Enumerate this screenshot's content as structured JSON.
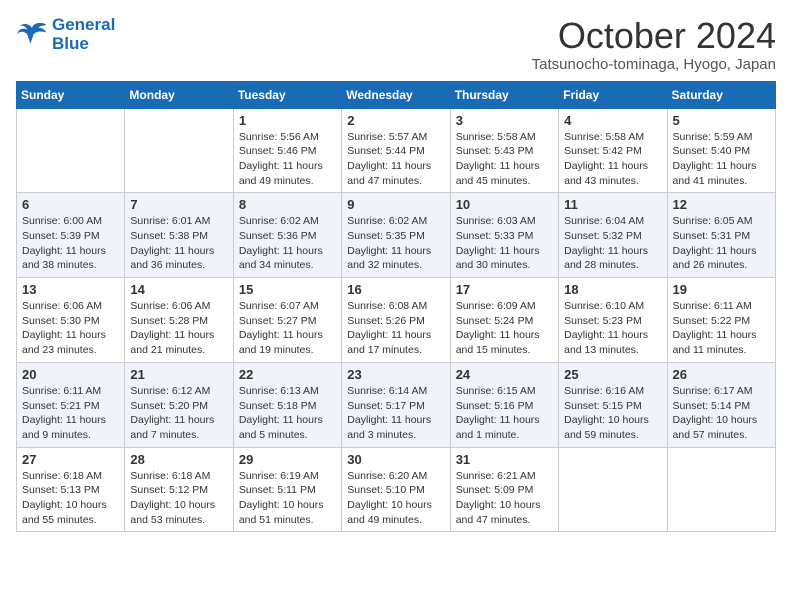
{
  "header": {
    "logo_line1": "General",
    "logo_line2": "Blue",
    "month": "October 2024",
    "location": "Tatsunocho-tominaga, Hyogo, Japan"
  },
  "weekdays": [
    "Sunday",
    "Monday",
    "Tuesday",
    "Wednesday",
    "Thursday",
    "Friday",
    "Saturday"
  ],
  "weeks": [
    [
      {
        "day": "",
        "sunrise": "",
        "sunset": "",
        "daylight": ""
      },
      {
        "day": "",
        "sunrise": "",
        "sunset": "",
        "daylight": ""
      },
      {
        "day": "1",
        "sunrise": "Sunrise: 5:56 AM",
        "sunset": "Sunset: 5:46 PM",
        "daylight": "Daylight: 11 hours and 49 minutes."
      },
      {
        "day": "2",
        "sunrise": "Sunrise: 5:57 AM",
        "sunset": "Sunset: 5:44 PM",
        "daylight": "Daylight: 11 hours and 47 minutes."
      },
      {
        "day": "3",
        "sunrise": "Sunrise: 5:58 AM",
        "sunset": "Sunset: 5:43 PM",
        "daylight": "Daylight: 11 hours and 45 minutes."
      },
      {
        "day": "4",
        "sunrise": "Sunrise: 5:58 AM",
        "sunset": "Sunset: 5:42 PM",
        "daylight": "Daylight: 11 hours and 43 minutes."
      },
      {
        "day": "5",
        "sunrise": "Sunrise: 5:59 AM",
        "sunset": "Sunset: 5:40 PM",
        "daylight": "Daylight: 11 hours and 41 minutes."
      }
    ],
    [
      {
        "day": "6",
        "sunrise": "Sunrise: 6:00 AM",
        "sunset": "Sunset: 5:39 PM",
        "daylight": "Daylight: 11 hours and 38 minutes."
      },
      {
        "day": "7",
        "sunrise": "Sunrise: 6:01 AM",
        "sunset": "Sunset: 5:38 PM",
        "daylight": "Daylight: 11 hours and 36 minutes."
      },
      {
        "day": "8",
        "sunrise": "Sunrise: 6:02 AM",
        "sunset": "Sunset: 5:36 PM",
        "daylight": "Daylight: 11 hours and 34 minutes."
      },
      {
        "day": "9",
        "sunrise": "Sunrise: 6:02 AM",
        "sunset": "Sunset: 5:35 PM",
        "daylight": "Daylight: 11 hours and 32 minutes."
      },
      {
        "day": "10",
        "sunrise": "Sunrise: 6:03 AM",
        "sunset": "Sunset: 5:33 PM",
        "daylight": "Daylight: 11 hours and 30 minutes."
      },
      {
        "day": "11",
        "sunrise": "Sunrise: 6:04 AM",
        "sunset": "Sunset: 5:32 PM",
        "daylight": "Daylight: 11 hours and 28 minutes."
      },
      {
        "day": "12",
        "sunrise": "Sunrise: 6:05 AM",
        "sunset": "Sunset: 5:31 PM",
        "daylight": "Daylight: 11 hours and 26 minutes."
      }
    ],
    [
      {
        "day": "13",
        "sunrise": "Sunrise: 6:06 AM",
        "sunset": "Sunset: 5:30 PM",
        "daylight": "Daylight: 11 hours and 23 minutes."
      },
      {
        "day": "14",
        "sunrise": "Sunrise: 6:06 AM",
        "sunset": "Sunset: 5:28 PM",
        "daylight": "Daylight: 11 hours and 21 minutes."
      },
      {
        "day": "15",
        "sunrise": "Sunrise: 6:07 AM",
        "sunset": "Sunset: 5:27 PM",
        "daylight": "Daylight: 11 hours and 19 minutes."
      },
      {
        "day": "16",
        "sunrise": "Sunrise: 6:08 AM",
        "sunset": "Sunset: 5:26 PM",
        "daylight": "Daylight: 11 hours and 17 minutes."
      },
      {
        "day": "17",
        "sunrise": "Sunrise: 6:09 AM",
        "sunset": "Sunset: 5:24 PM",
        "daylight": "Daylight: 11 hours and 15 minutes."
      },
      {
        "day": "18",
        "sunrise": "Sunrise: 6:10 AM",
        "sunset": "Sunset: 5:23 PM",
        "daylight": "Daylight: 11 hours and 13 minutes."
      },
      {
        "day": "19",
        "sunrise": "Sunrise: 6:11 AM",
        "sunset": "Sunset: 5:22 PM",
        "daylight": "Daylight: 11 hours and 11 minutes."
      }
    ],
    [
      {
        "day": "20",
        "sunrise": "Sunrise: 6:11 AM",
        "sunset": "Sunset: 5:21 PM",
        "daylight": "Daylight: 11 hours and 9 minutes."
      },
      {
        "day": "21",
        "sunrise": "Sunrise: 6:12 AM",
        "sunset": "Sunset: 5:20 PM",
        "daylight": "Daylight: 11 hours and 7 minutes."
      },
      {
        "day": "22",
        "sunrise": "Sunrise: 6:13 AM",
        "sunset": "Sunset: 5:18 PM",
        "daylight": "Daylight: 11 hours and 5 minutes."
      },
      {
        "day": "23",
        "sunrise": "Sunrise: 6:14 AM",
        "sunset": "Sunset: 5:17 PM",
        "daylight": "Daylight: 11 hours and 3 minutes."
      },
      {
        "day": "24",
        "sunrise": "Sunrise: 6:15 AM",
        "sunset": "Sunset: 5:16 PM",
        "daylight": "Daylight: 11 hours and 1 minute."
      },
      {
        "day": "25",
        "sunrise": "Sunrise: 6:16 AM",
        "sunset": "Sunset: 5:15 PM",
        "daylight": "Daylight: 10 hours and 59 minutes."
      },
      {
        "day": "26",
        "sunrise": "Sunrise: 6:17 AM",
        "sunset": "Sunset: 5:14 PM",
        "daylight": "Daylight: 10 hours and 57 minutes."
      }
    ],
    [
      {
        "day": "27",
        "sunrise": "Sunrise: 6:18 AM",
        "sunset": "Sunset: 5:13 PM",
        "daylight": "Daylight: 10 hours and 55 minutes."
      },
      {
        "day": "28",
        "sunrise": "Sunrise: 6:18 AM",
        "sunset": "Sunset: 5:12 PM",
        "daylight": "Daylight: 10 hours and 53 minutes."
      },
      {
        "day": "29",
        "sunrise": "Sunrise: 6:19 AM",
        "sunset": "Sunset: 5:11 PM",
        "daylight": "Daylight: 10 hours and 51 minutes."
      },
      {
        "day": "30",
        "sunrise": "Sunrise: 6:20 AM",
        "sunset": "Sunset: 5:10 PM",
        "daylight": "Daylight: 10 hours and 49 minutes."
      },
      {
        "day": "31",
        "sunrise": "Sunrise: 6:21 AM",
        "sunset": "Sunset: 5:09 PM",
        "daylight": "Daylight: 10 hours and 47 minutes."
      },
      {
        "day": "",
        "sunrise": "",
        "sunset": "",
        "daylight": ""
      },
      {
        "day": "",
        "sunrise": "",
        "sunset": "",
        "daylight": ""
      }
    ]
  ]
}
